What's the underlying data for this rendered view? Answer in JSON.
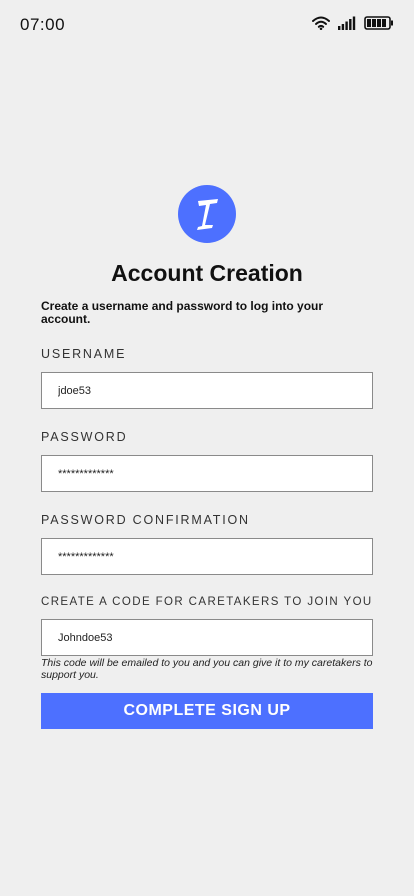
{
  "status_bar": {
    "time": "07:00",
    "icons": [
      "wifi-icon",
      "signal-icon",
      "battery-icon"
    ]
  },
  "logo": {
    "icon": "app-logo-icon",
    "color": "#4d70ff"
  },
  "title": "Account Creation",
  "subtitle": "Create a username and password to log into your account.",
  "form": {
    "username": {
      "label": "USERNAME",
      "value": "jdoe53"
    },
    "password": {
      "label": "PASSWORD",
      "value": "*************"
    },
    "password_confirmation": {
      "label": "PASSWORD CONFIRMATION",
      "value": "*************"
    },
    "caretaker_code": {
      "label": "CREATE A CODE FOR CARETAKERS TO JOIN YOU",
      "value": "Johndoe53",
      "hint": "This code will be emailed to you and you can give it to my caretakers to support you."
    }
  },
  "submit_label": "COMPLETE SIGN UP",
  "colors": {
    "accent": "#4d70ff",
    "background": "#efefef"
  }
}
